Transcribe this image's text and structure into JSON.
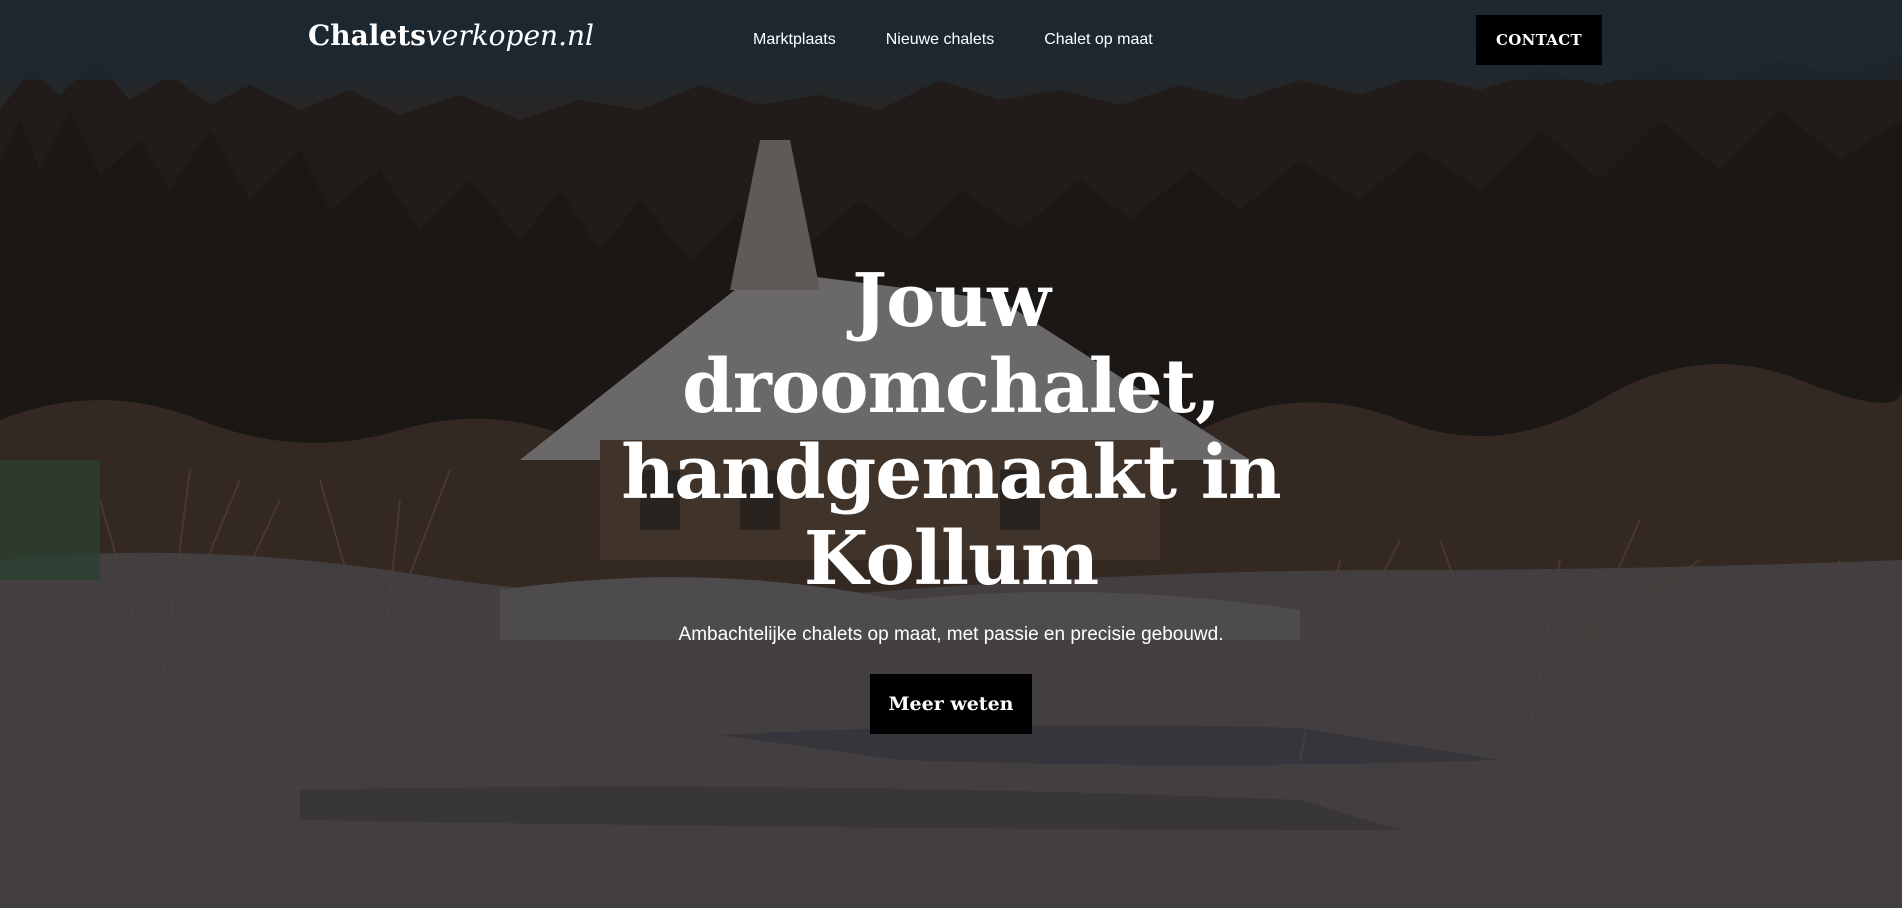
{
  "header": {
    "logo_bold": "Chalets",
    "logo_italic": "verkopen.nl",
    "nav": [
      {
        "label": "Marktplaats"
      },
      {
        "label": "Nieuwe chalets"
      },
      {
        "label": "Chalet op maat"
      }
    ],
    "contact_label": "CONTACT"
  },
  "hero": {
    "title": "Jouw droomchalet, handgemaakt in Kollum",
    "subtitle": "Ambachtelijke chalets op maat, met passie en precisie gebouwd.",
    "cta_label": "Meer weten",
    "background": "snowy-forest-chalet-photo"
  },
  "colors": {
    "header_bg": "#1f2a33",
    "button_bg": "#000000",
    "text": "#ffffff"
  }
}
